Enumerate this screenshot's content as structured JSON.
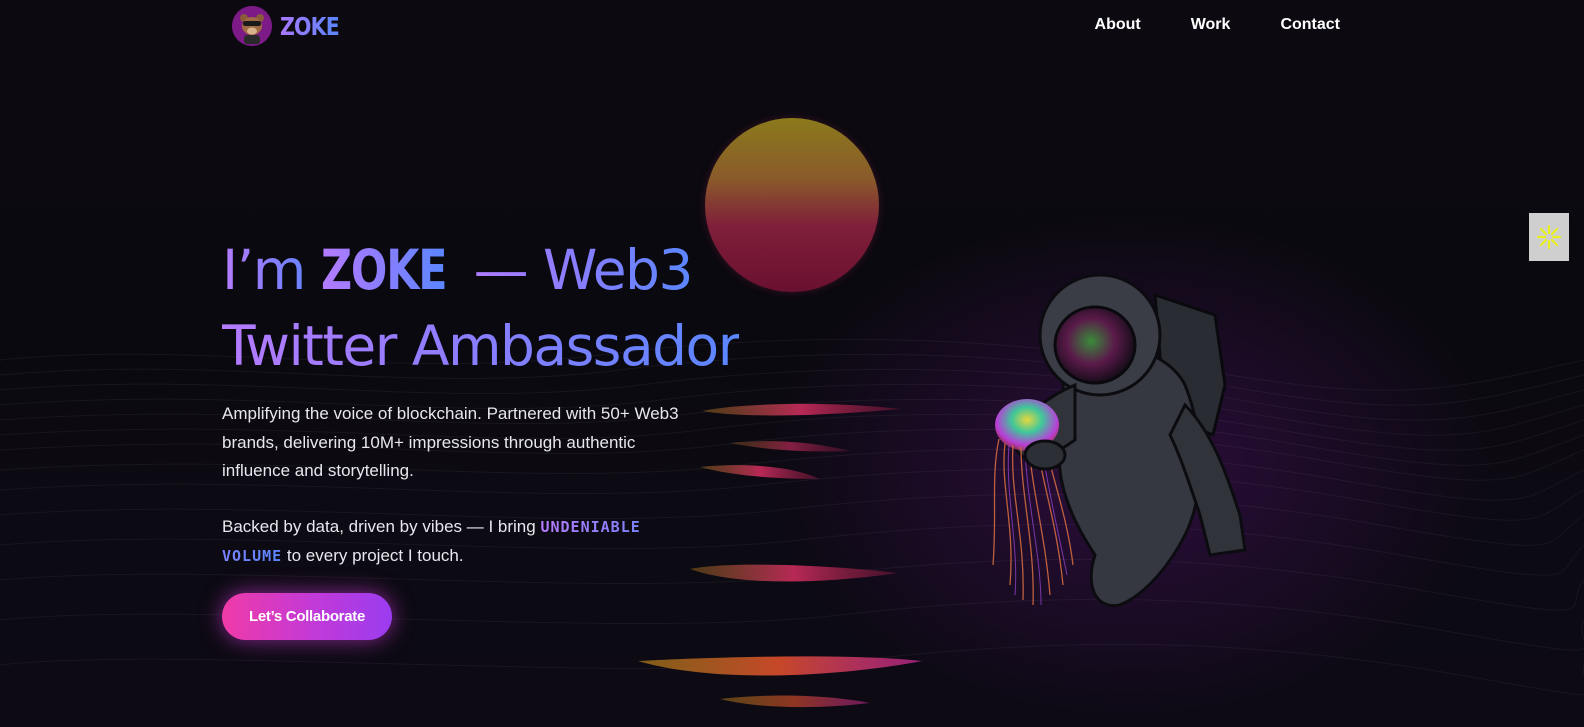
{
  "brand": {
    "name": "ZOKE",
    "avatar_icon": "bear-avatar-icon"
  },
  "nav": {
    "links": [
      {
        "label": "About"
      },
      {
        "label": "Work"
      },
      {
        "label": "Contact"
      }
    ]
  },
  "hero": {
    "title_prefix": "I’m ",
    "title_name": "ZOKE",
    "title_suffix": " — Web3",
    "title_line2": "Twitter Ambassador",
    "description": "Amplifying the voice of blockchain. Partnered with 50+ Web3 brands, delivering 10M+ impressions through authentic influence and storytelling.",
    "tagline_start": "Backed by data, driven by vibes — I bring ",
    "tagline_highlight": "UNDENIABLE VOLUME",
    "tagline_end": " to every project I touch.",
    "cta_label": "Let’s Collaborate"
  },
  "art": {
    "sun": "sun-graphic",
    "reflections": "sun-reflection-graphic",
    "figure": "astronaut-with-jellyfish-illustration"
  },
  "side_widget": {
    "icon": "sparkle-icon"
  },
  "colors": {
    "background": "#0b0910",
    "gradient_start": "#b57bff",
    "gradient_end": "#5a86ff",
    "cta_start": "#f03aa8",
    "cta_end": "#9b3cf0",
    "sparkle": "#e8f020"
  }
}
